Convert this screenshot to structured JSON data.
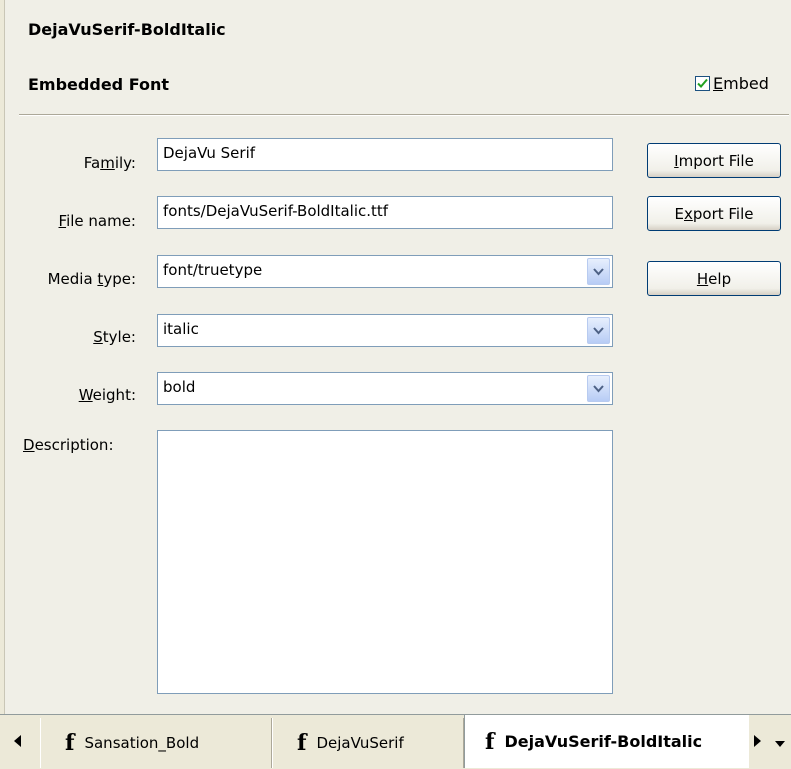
{
  "header": {
    "title": "DejaVuSerif-BoldItalic",
    "section": "Embedded Font"
  },
  "embed": {
    "checked": true,
    "label_prefix": "",
    "label_ul": "E",
    "label_rest": "mbed"
  },
  "fields": {
    "family": {
      "label_pre": "Fa",
      "label_ul": "m",
      "label_post": "ily:",
      "value": "DejaVu Serif"
    },
    "file_name": {
      "label_pre": "",
      "label_ul": "F",
      "label_post": "ile name:",
      "value": "fonts/DejaVuSerif-BoldItalic.ttf"
    },
    "media_type": {
      "label_pre": "Media ",
      "label_ul": "t",
      "label_post": "ype:",
      "value": "font/truetype"
    },
    "style": {
      "label_pre": "",
      "label_ul": "S",
      "label_post": "tyle:",
      "value": "italic"
    },
    "weight": {
      "label_pre": "",
      "label_ul": "W",
      "label_post": "eight:",
      "value": "bold"
    },
    "description": {
      "label_pre": "",
      "label_ul": "D",
      "label_post": "escription:",
      "value": ""
    }
  },
  "buttons": {
    "import": {
      "pre": "",
      "ul": "I",
      "post": "mport File"
    },
    "export": {
      "pre": "E",
      "ul": "x",
      "post": "port File"
    },
    "help": {
      "pre": "",
      "ul": "H",
      "post": "elp"
    }
  },
  "tabs": [
    {
      "icon": "f",
      "label": "Sansation_Bold"
    },
    {
      "icon": "f",
      "label": "DejaVuSerif"
    },
    {
      "icon": "f",
      "label": "DejaVuSerif-BoldItalic"
    }
  ],
  "icons": {
    "checkmark": "check-icon",
    "dropdown": "chevron-down-icon",
    "tab_left": "arrow-left-icon",
    "tab_right": "arrow-right-icon",
    "tab_menu": "menu-down-icon"
  },
  "colors": {
    "accent": "#316ac5",
    "border": "#7f9db9",
    "check": "#21a121"
  }
}
